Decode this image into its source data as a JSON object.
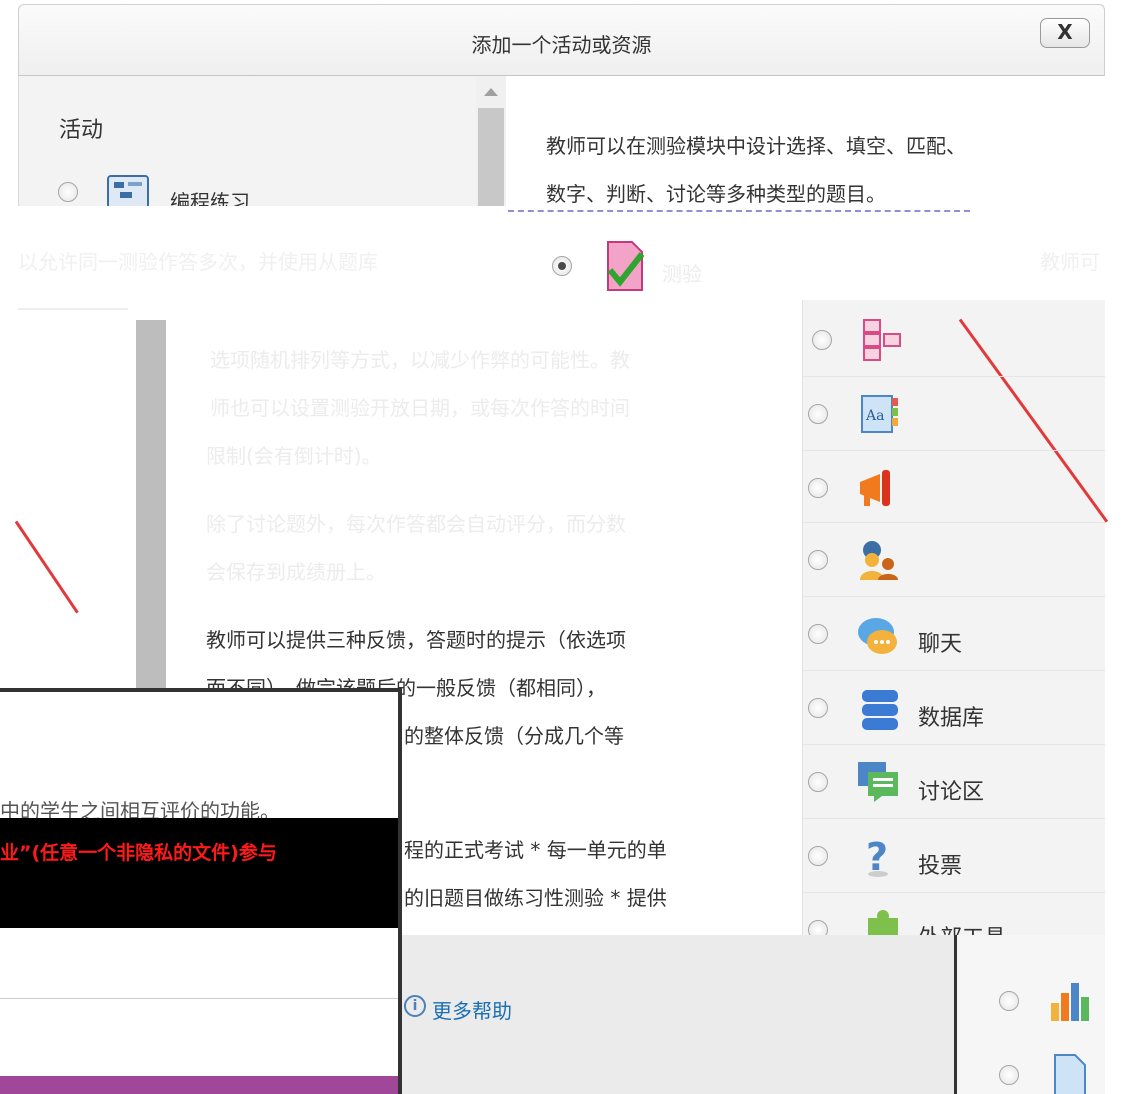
{
  "dialog": {
    "title": "添加一个活动或资源",
    "close_label": "X"
  },
  "activity_list": {
    "section_label": "活动",
    "items": [
      {
        "label": "编程练习",
        "icon": "programming-exercise-icon",
        "selected": false
      },
      {
        "label": "测验",
        "icon": "quiz-icon",
        "selected": true
      }
    ]
  },
  "description": {
    "top_lines": [
      "教师可以在测验模块中设计选择、填空、匹配、",
      "数字、判断、讨论等多种类型的题目。"
    ],
    "ghost_left": "以允许同一测验作答多次，并使用从题库",
    "ghost_right": "教师可",
    "faint_lines": [
      "选项随机排列等方式，以减少作弊的可能性。教",
      "师也可以设置测验开放日期，或每次作答的时间",
      "限制(会有倒计时)。",
      "除了讨论题外，每次作答都会自动评分，而分数",
      "会保存到成绩册上。"
    ],
    "visible_lines": [
      "教师可以提供三种反馈，答题时的提示（依选项",
      "而不同），做完该题后的一般反馈（都相同），",
      "的整体反馈（分成几个等",
      "程的正式考试 * 每一单元的单",
      "的旧题目做练习性测验 * 提供"
    ]
  },
  "right_modules": [
    {
      "label": "",
      "icon": "book-structure-icon"
    },
    {
      "label": "",
      "icon": "glossary-icon"
    },
    {
      "label": "",
      "icon": "announcement-megaphone-icon"
    },
    {
      "label": "",
      "icon": "users-group-icon"
    },
    {
      "label": "聊天",
      "icon": "chat-bubble-icon"
    },
    {
      "label": "数据库",
      "icon": "database-icon"
    },
    {
      "label": "讨论区",
      "icon": "forum-icon"
    },
    {
      "label": "投票",
      "icon": "question-mark-icon"
    },
    {
      "label": "外部工具",
      "icon": "puzzle-icon"
    }
  ],
  "sub_window": {
    "line1": "中的学生之间相互评价的功能。",
    "red_line": "业”(任意一个非隐私的文件)参与"
  },
  "footer": {
    "help_label": "更多帮助"
  },
  "colors": {
    "accent_link": "#1a6fb3",
    "purple_bar": "#a0479a",
    "red_text": "#ff1a1a"
  }
}
